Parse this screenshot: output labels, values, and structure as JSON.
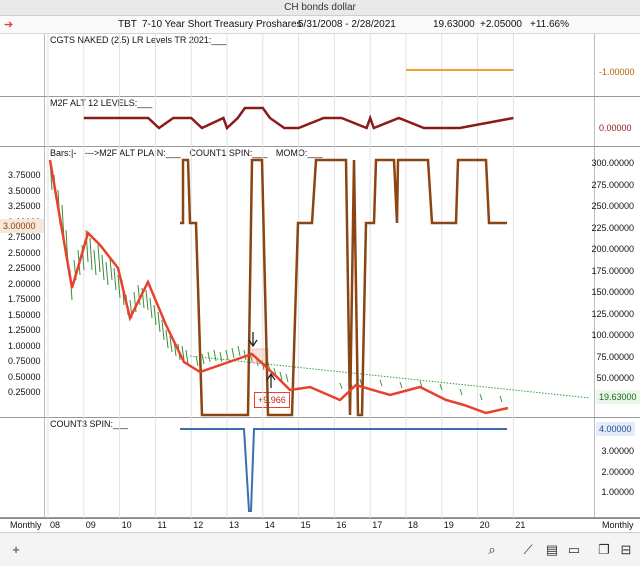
{
  "window": {
    "title": "CH bonds dollar"
  },
  "header": {
    "symbol": "TBT",
    "name": "7-10 Year Short Treasury Proshares",
    "date_range": "5/31/2008 - 2/28/2021",
    "last": "19.63000",
    "change": "+2.05000",
    "change_pct": "+11.66%"
  },
  "panels": {
    "p1": {
      "label": "CGTS NAKED (2.5) LR Levels TR 2021:___",
      "value": "-1.00000"
    },
    "p2": {
      "label": "M2F ALT 12 LEVELS:___",
      "value": "0.00000"
    },
    "p3": {
      "labels": [
        "Bars:|-",
        "--->M2F ALT PLAIN:___",
        "COUNT1 SPIN:___",
        "MOMO:___"
      ],
      "left_value": "3.00000",
      "right_value": "19.63000",
      "annotation": "+9.966",
      "left_ticks": [
        "3.75000",
        "3.50000",
        "3.25000",
        "3.00000",
        "2.75000",
        "2.50000",
        "2.25000",
        "2.00000",
        "1.75000",
        "1.50000",
        "1.25000",
        "1.00000",
        "0.75000",
        "0.50000",
        "0.25000"
      ],
      "right_ticks": [
        "300.00000",
        "275.00000",
        "250.00000",
        "225.00000",
        "200.00000",
        "175.00000",
        "150.00000",
        "125.00000",
        "100.00000",
        "75.00000",
        "50.00000"
      ]
    },
    "p4": {
      "label": "COUNT3 SPIN:___",
      "value": "4.00000",
      "right_ticks": [
        "3.00000",
        "2.00000",
        "1.00000"
      ]
    }
  },
  "xaxis": {
    "labels": [
      "08",
      "09",
      "10",
      "11",
      "12",
      "13",
      "14",
      "15",
      "16",
      "17",
      "18",
      "19",
      "20",
      "21"
    ]
  },
  "periodicity": {
    "left": "Monthly",
    "right": "Monthly"
  },
  "colors": {
    "orange": "#f0a030",
    "maroon": "#8b1a1a",
    "brown": "#8b4513",
    "red": "#e8412c",
    "green": "#3a9a3a",
    "blue": "#3c6fb0"
  },
  "toolbar": {
    "icons": [
      "plus-icon",
      "search-icon",
      "draw-line-icon",
      "chart-type-icon",
      "panel-icon",
      "book-icon",
      "layout-icon"
    ]
  },
  "chart_data": [
    {
      "type": "line",
      "title": "CGTS NAKED (2.5) LR Levels TR 2021",
      "series": [
        {
          "name": "CGTS NAKED (2.5) LR Levels TR 2021",
          "x": [
            2018.0,
            2021.0
          ],
          "values": [
            -1,
            -1
          ]
        }
      ]
    },
    {
      "type": "line",
      "title": "M2F ALT 12 LEVELS",
      "series": [
        {
          "name": "M2F ALT 12 LEVELS",
          "x": [
            2009.0,
            2010.8,
            2011.1,
            2011.5,
            2012.0,
            2012.3,
            2012.9,
            2013.0,
            2013.3,
            2013.5,
            2014.0,
            2014.2,
            2014.6,
            2015.0,
            2015.7,
            2016.2,
            2016.9,
            2017.0,
            2017.1,
            2017.8,
            2018.5,
            2019.5,
            2021.0
          ],
          "values": [
            1,
            1,
            0,
            1,
            1,
            0,
            1,
            0,
            1,
            2,
            2,
            1,
            0,
            0,
            1,
            1,
            0,
            1,
            0,
            1,
            0,
            0,
            1
          ]
        }
      ]
    }
  ]
}
